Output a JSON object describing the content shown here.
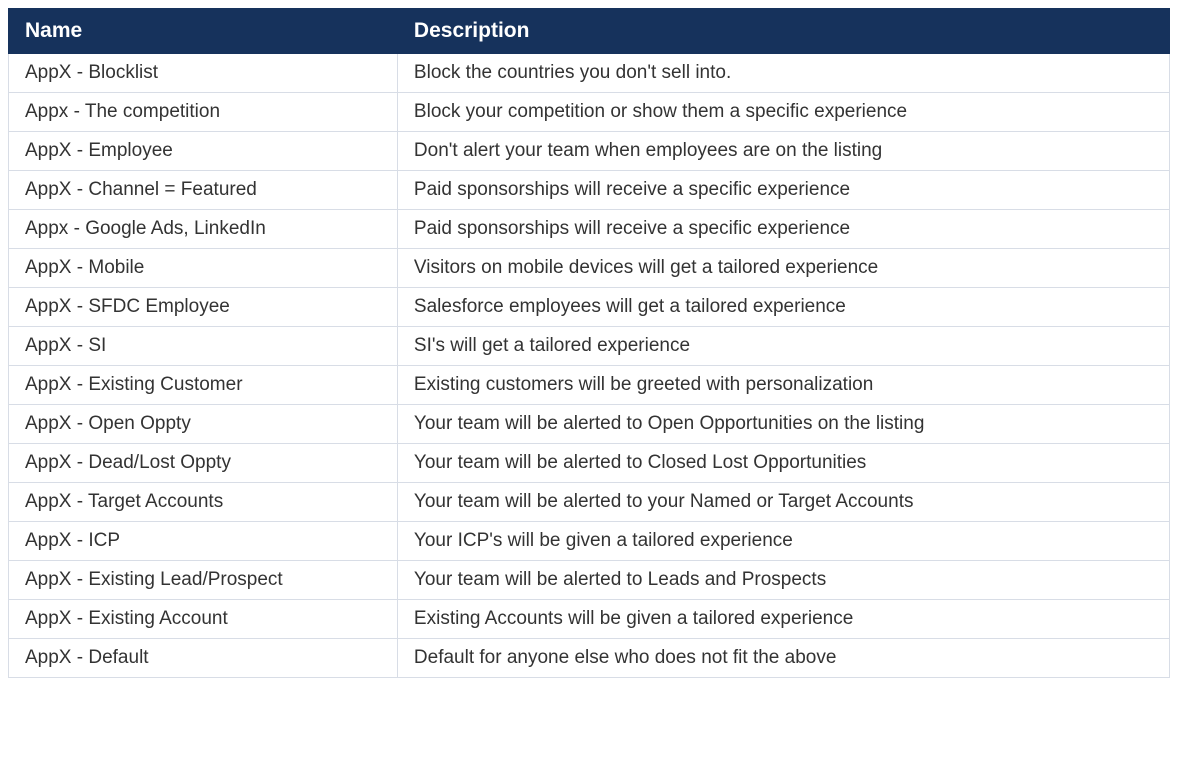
{
  "table": {
    "headers": {
      "name": "Name",
      "description": "Description"
    },
    "rows": [
      {
        "name": "AppX - Blocklist",
        "description": "Block the countries you don't sell into."
      },
      {
        "name": "Appx - The competition",
        "description": "Block your competition or show them a specific experience"
      },
      {
        "name": "AppX - Employee",
        "description": "Don't alert your team when employees are on the listing"
      },
      {
        "name": "AppX - Channel = Featured",
        "description": "Paid sponsorships will receive a specific experience"
      },
      {
        "name": "Appx - Google Ads, LinkedIn",
        "description": "Paid sponsorships will receive a specific experience"
      },
      {
        "name": "AppX - Mobile",
        "description": "Visitors on mobile devices will get a tailored experience"
      },
      {
        "name": "AppX - SFDC Employee",
        "description": "Salesforce employees will get a tailored experience"
      },
      {
        "name": "AppX - SI",
        "description": "SI's will get a tailored experience"
      },
      {
        "name": "AppX - Existing Customer",
        "description": "Existing customers will be greeted with personalization"
      },
      {
        "name": "AppX - Open Oppty",
        "description": "Your team will be alerted to Open Opportunities on the listing"
      },
      {
        "name": "AppX - Dead/Lost Oppty",
        "description": "Your team will be alerted to Closed Lost Opportunities"
      },
      {
        "name": "AppX - Target Accounts",
        "description": "Your team will be alerted to your Named or Target Accounts"
      },
      {
        "name": "AppX - ICP",
        "description": "Your ICP's will be given a tailored experience"
      },
      {
        "name": "AppX - Existing Lead/Prospect",
        "description": "Your team will be alerted to Leads and Prospects"
      },
      {
        "name": "AppX - Existing Account",
        "description": "Existing Accounts will be given a tailored experience"
      },
      {
        "name": "AppX - Default",
        "description": "Default for anyone else who does not fit the above"
      }
    ]
  }
}
